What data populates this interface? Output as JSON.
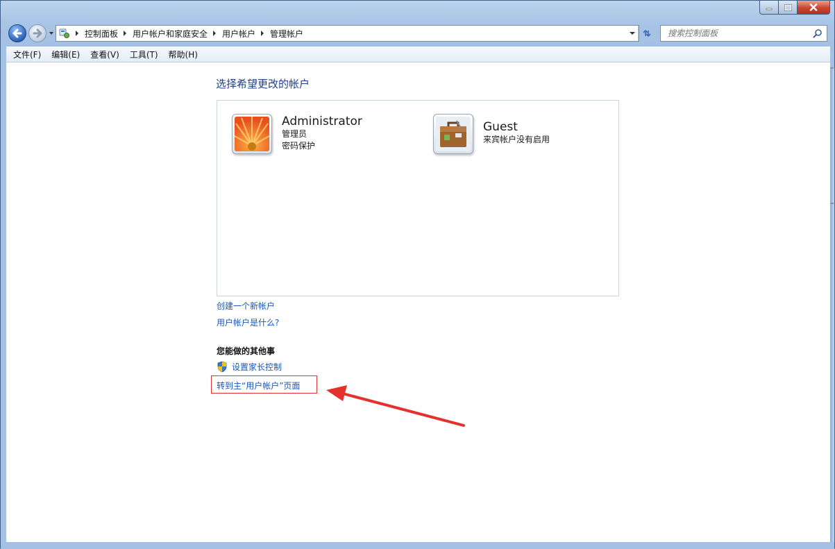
{
  "nav": {
    "breadcrumbs": [
      "控制面板",
      "用户帐户和家庭安全",
      "用户帐户",
      "管理帐户"
    ],
    "search_placeholder": "搜索控制面板"
  },
  "menu": {
    "items": [
      "文件(F)",
      "编辑(E)",
      "查看(V)",
      "工具(T)",
      "帮助(H)"
    ]
  },
  "main": {
    "title": "选择希望更改的帐户",
    "accounts": [
      {
        "name": "Administrator",
        "details": [
          "管理员",
          "密码保护"
        ],
        "picture": "flower-icon"
      },
      {
        "name": "Guest",
        "details": [
          "来宾帐户没有启用"
        ],
        "picture": "suitcase-icon"
      }
    ],
    "links": {
      "create_account": "创建一个新帐户",
      "what_is_account": "用户帐户是什么?"
    },
    "other_section_title": "您能做的其他事",
    "tasks": {
      "parental_controls": "设置家长控制",
      "goto_main": "转到主“用户帐户”页面"
    }
  },
  "colors": {
    "link": "#1e55b4",
    "title": "#1e3f8b",
    "annotation": "#e03030"
  }
}
